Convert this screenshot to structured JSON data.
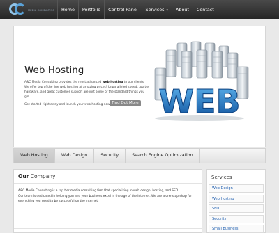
{
  "brand": {
    "logo_text": "AC",
    "tagline": "MEDIA CONSULTING"
  },
  "nav": {
    "items": [
      {
        "label": "Home"
      },
      {
        "label": "Portfolio"
      },
      {
        "label": "Control Panel"
      },
      {
        "label": "Services"
      },
      {
        "label": "About"
      },
      {
        "label": "Contact"
      }
    ],
    "services_caret": "▾"
  },
  "hero": {
    "title": "Web Hosting",
    "paragraph_before": "A&C Media Consulting provides the most advanced ",
    "paragraph_bold": "web hosting",
    "paragraph_after": " to our clients. We offer top of the line web hosting at amazing prices! Unparalleled speed, top tier hardware, and great customer support are just some of the standard things you get.",
    "cta_text": "Get started right away and launch your web hosting now.",
    "button_label": "Find Out More",
    "image_word": "WEB"
  },
  "tabs": [
    {
      "label": "Web Hosting",
      "active": true
    },
    {
      "label": "Web Design",
      "active": false
    },
    {
      "label": "Security",
      "active": false
    },
    {
      "label": "Search Engine Optimization",
      "active": false
    }
  ],
  "company": {
    "title_bold": "Our",
    "title_rest": " Company",
    "text_1": "A&C Media Consulting is a top tier media consulting firm that specializing in web design, hosting, and SEO.",
    "text_2": "Our team is dedicated in helping you and your business excel in the age of the Internet. We are a one stop shop for everything you need to be successful on the internet."
  },
  "services": {
    "title": "Services",
    "items": [
      {
        "label": "Web Design"
      },
      {
        "label": "Web Hosting"
      },
      {
        "label": "SEO"
      },
      {
        "label": "Security"
      },
      {
        "label": "Small Business"
      }
    ]
  },
  "colors": {
    "nav_bg": "#2e2e2e",
    "link": "#1f5fb0",
    "button": "#888888",
    "logo_blue": "#5aa2d8"
  }
}
